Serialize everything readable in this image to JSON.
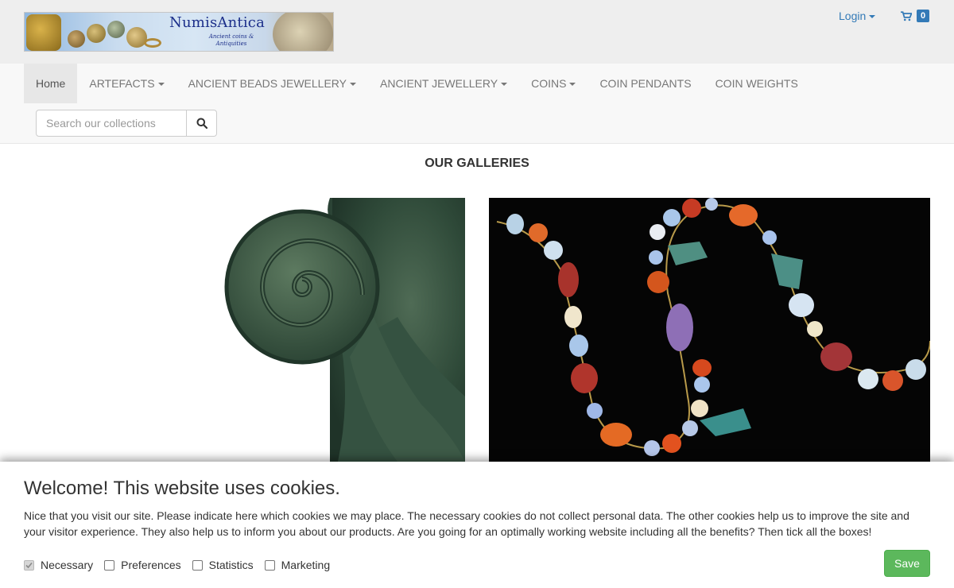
{
  "header": {
    "logo_brand": "NumisAntica",
    "logo_tagline": "Ancient coins & Antiquities",
    "login_label": "Login",
    "cart_icon": "shopping-cart-icon",
    "cart_count": "0"
  },
  "nav": {
    "items": [
      {
        "label": "Home"
      },
      {
        "label": "ARTEFACTS"
      },
      {
        "label": "ANCIENT BEADS JEWELLERY"
      },
      {
        "label": "ANCIENT JEWELLERY"
      },
      {
        "label": "COINS"
      },
      {
        "label": "COIN PENDANTS"
      },
      {
        "label": "COIN WEIGHTS"
      }
    ]
  },
  "search": {
    "placeholder": "Search our collections",
    "value": "",
    "icon": "search-icon"
  },
  "main": {
    "title": "OUR GALLERIES"
  },
  "cookie": {
    "title": "Welcome! This website uses cookies.",
    "text": "Nice that you visit our site. Please indicate here which cookies we may place. The necessary cookies do not collect personal data. The other cookies help us to improve the site and your visitor experience. They also help us to inform you about our products. Are you going for an optimally working website including all the benefits? Then tick all the boxes!",
    "options": [
      {
        "label": "Necessary",
        "checked": true,
        "disabled": true
      },
      {
        "label": "Preferences",
        "checked": false
      },
      {
        "label": "Statistics",
        "checked": false
      },
      {
        "label": "Marketing",
        "checked": false
      }
    ],
    "save_label": "Save"
  },
  "colors": {
    "link": "#337ab7",
    "save": "#5cb85c",
    "navbar_bg": "#f8f8f8",
    "topbar_bg": "#eeeeee"
  }
}
